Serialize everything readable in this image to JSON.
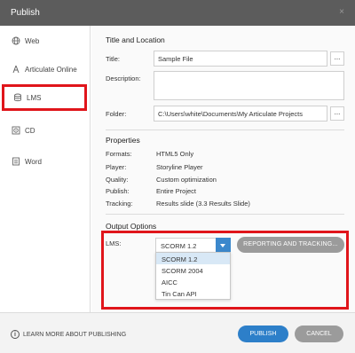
{
  "window": {
    "title": "Publish",
    "close_label": "×"
  },
  "sidebar": {
    "items": [
      {
        "label": "Web",
        "icon": "globe-icon"
      },
      {
        "label": "Articulate Online",
        "icon": "articulate-online-icon"
      },
      {
        "label": "LMS",
        "icon": "database-icon",
        "selected": true
      },
      {
        "label": "CD",
        "icon": "disc-icon"
      },
      {
        "label": "Word",
        "icon": "document-icon"
      }
    ]
  },
  "title_location": {
    "heading": "Title and Location",
    "title_label": "Title:",
    "title_value": "Sample File",
    "description_label": "Description:",
    "description_value": "",
    "folder_label": "Folder:",
    "folder_value": "C:\\Users\\white\\Documents\\My Articulate Projects",
    "browse_label": "..."
  },
  "properties": {
    "heading": "Properties",
    "rows": [
      {
        "label": "Formats:",
        "value": "HTML5 Only"
      },
      {
        "label": "Player:",
        "value": "Storyline Player"
      },
      {
        "label": "Quality:",
        "value": "Custom optimization"
      },
      {
        "label": "Publish:",
        "value": "Entire Project"
      },
      {
        "label": "Tracking:",
        "value": "Results slide (3.3 Results Slide)"
      }
    ]
  },
  "output": {
    "heading": "Output Options",
    "lms_label": "LMS:",
    "lms_selected": "SCORM 1.2",
    "lms_options": [
      "SCORM 1.2",
      "SCORM 2004",
      "AICC",
      "Tin Can API"
    ],
    "reporting_button": "REPORTING AND TRACKING..."
  },
  "footer": {
    "learn_more": "LEARN MORE ABOUT PUBLISHING",
    "info_icon": "i",
    "publish_button": "PUBLISH",
    "cancel_button": "CANCEL"
  },
  "colors": {
    "accent": "#2d7fc9",
    "highlight": "#e0151b",
    "titlebar": "#5c5c5c"
  }
}
